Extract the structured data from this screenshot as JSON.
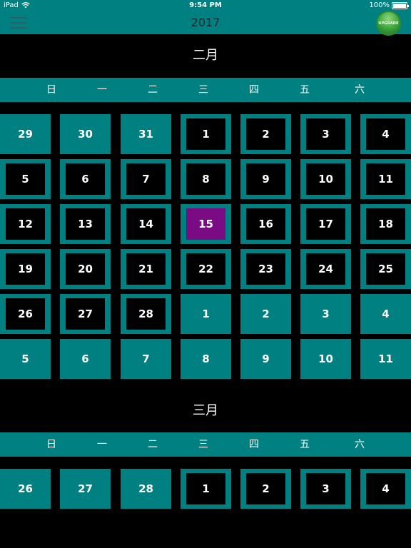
{
  "status_bar": {
    "device": "iPad",
    "time": "9:54 PM",
    "battery": "100%"
  },
  "nav": {
    "title": "2017",
    "upgrade_label": "UPGRADE",
    "menu_icon": "hamburger-icon"
  },
  "colors": {
    "teal": "#008080",
    "selected": "#7b0a85",
    "background": "#000000"
  },
  "weekdays": [
    "日",
    "一",
    "二",
    "三",
    "四",
    "五",
    "六"
  ],
  "months": [
    {
      "name": "二月",
      "weeks": [
        [
          {
            "d": "29",
            "cur": false
          },
          {
            "d": "30",
            "cur": false
          },
          {
            "d": "31",
            "cur": false
          },
          {
            "d": "1",
            "cur": true
          },
          {
            "d": "2",
            "cur": true
          },
          {
            "d": "3",
            "cur": true
          },
          {
            "d": "4",
            "cur": true
          }
        ],
        [
          {
            "d": "5",
            "cur": true
          },
          {
            "d": "6",
            "cur": true
          },
          {
            "d": "7",
            "cur": true
          },
          {
            "d": "8",
            "cur": true
          },
          {
            "d": "9",
            "cur": true
          },
          {
            "d": "10",
            "cur": true
          },
          {
            "d": "11",
            "cur": true
          }
        ],
        [
          {
            "d": "12",
            "cur": true
          },
          {
            "d": "13",
            "cur": true
          },
          {
            "d": "14",
            "cur": true
          },
          {
            "d": "15",
            "cur": true,
            "selected": true
          },
          {
            "d": "16",
            "cur": true
          },
          {
            "d": "17",
            "cur": true
          },
          {
            "d": "18",
            "cur": true
          }
        ],
        [
          {
            "d": "19",
            "cur": true
          },
          {
            "d": "20",
            "cur": true
          },
          {
            "d": "21",
            "cur": true
          },
          {
            "d": "22",
            "cur": true
          },
          {
            "d": "23",
            "cur": true
          },
          {
            "d": "24",
            "cur": true
          },
          {
            "d": "25",
            "cur": true
          }
        ],
        [
          {
            "d": "26",
            "cur": true
          },
          {
            "d": "27",
            "cur": true
          },
          {
            "d": "28",
            "cur": true
          },
          {
            "d": "1",
            "cur": false
          },
          {
            "d": "2",
            "cur": false
          },
          {
            "d": "3",
            "cur": false
          },
          {
            "d": "4",
            "cur": false
          }
        ],
        [
          {
            "d": "5",
            "cur": false
          },
          {
            "d": "6",
            "cur": false
          },
          {
            "d": "7",
            "cur": false
          },
          {
            "d": "8",
            "cur": false
          },
          {
            "d": "9",
            "cur": false
          },
          {
            "d": "10",
            "cur": false
          },
          {
            "d": "11",
            "cur": false
          }
        ]
      ]
    },
    {
      "name": "三月",
      "weeks": [
        [
          {
            "d": "26",
            "cur": false
          },
          {
            "d": "27",
            "cur": false
          },
          {
            "d": "28",
            "cur": false
          },
          {
            "d": "1",
            "cur": true
          },
          {
            "d": "2",
            "cur": true
          },
          {
            "d": "3",
            "cur": true
          },
          {
            "d": "4",
            "cur": true
          }
        ]
      ]
    }
  ]
}
